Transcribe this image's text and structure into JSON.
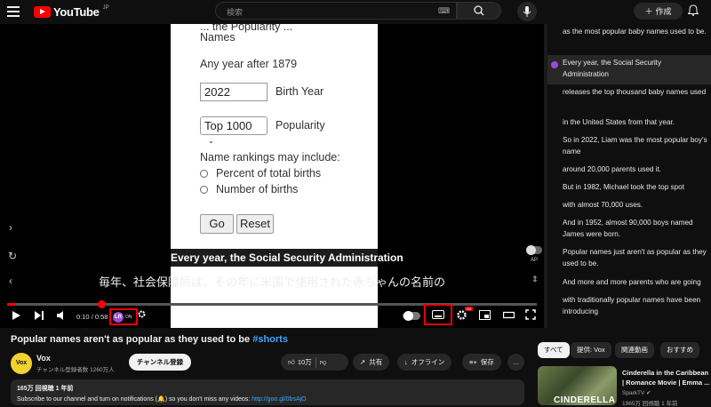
{
  "header": {
    "logo_text": "YouTube",
    "logo_sup": "JP",
    "search_placeholder": "検索",
    "create_label": "作成"
  },
  "video_frame": {
    "cut_text": "... the Popularity ...",
    "names_label": "Names",
    "year_hint": "Any year after 1879",
    "year_value": "2022",
    "year_label": "Birth Year",
    "popularity_value": "Top 1000",
    "popularity_label": "Popularity",
    "rankings_heading": "Name rankings may include:",
    "radio_1": "Percent of total births",
    "radio_2": "Number of births",
    "go_label": "Go",
    "reset_label": "Reset"
  },
  "captions": {
    "english": "Every year, the Social Security Administration",
    "japanese": "毎年、社会保障局は、その年に米国で使用された赤ちゃんの名前の"
  },
  "player": {
    "time_current": "0:10",
    "time_total": "0:58",
    "progress": 0.015,
    "ext_logo": "LR",
    "ext_state": "ON",
    "autoplay_label": "AP",
    "settings_badge": "HD"
  },
  "transcript": [
    {
      "text": "as the most popular baby names used to be.",
      "active": false
    },
    {
      "text": "Every year, the Social Security Administration",
      "active": true
    },
    {
      "text": "releases the top thousand baby names used",
      "active": false
    },
    {
      "text": "in the United States from that year.",
      "active": false
    },
    {
      "text": "So in 2022, Liam was the most popular boy's name",
      "active": false
    },
    {
      "text": "around 20,000 parents used it.",
      "active": false
    },
    {
      "text": "But in 1982, Michael took the top spot",
      "active": false
    },
    {
      "text": "with almost 70,000 uses.",
      "active": false
    },
    {
      "text": "And in 1952, almost 90,000 boys named James were born.",
      "active": false
    },
    {
      "text": "Popular names just aren't as popular as they used to be.",
      "active": false
    },
    {
      "text": "And more and more parents who are going",
      "active": false
    },
    {
      "text": "with traditionally popular names have been introducing",
      "active": false
    }
  ],
  "video_info": {
    "title": "Popular names aren't as popular as they used to be",
    "hashtag": "#shorts",
    "channel_name": "Vox",
    "channel_avatar": "Vox",
    "subscribers": "チャンネル登録者数 1260万人",
    "subscribe_label": "チャンネル登録",
    "like_count": "10万",
    "share_label": "共有",
    "offline_label": "オフライン",
    "save_label": "保存",
    "more_label": "…",
    "views_date": "165万 回視聴  1 年前",
    "description": "Subscribe to our channel and turn on notifications (🔔) so you don't miss any videos: ",
    "description_link": "http://goo.gl/0bsAjO"
  },
  "recommendations": {
    "chips": [
      "すべて",
      "提供: Vox",
      "関連動画",
      "おすすめ"
    ],
    "items": [
      {
        "title": "Cinderella in the Caribbean | Romance Movie | Emma ...",
        "channel": "SparkTV",
        "meta": "1965万 回視聴  1 年前",
        "thumb_text": "CINDERELLA"
      }
    ]
  }
}
